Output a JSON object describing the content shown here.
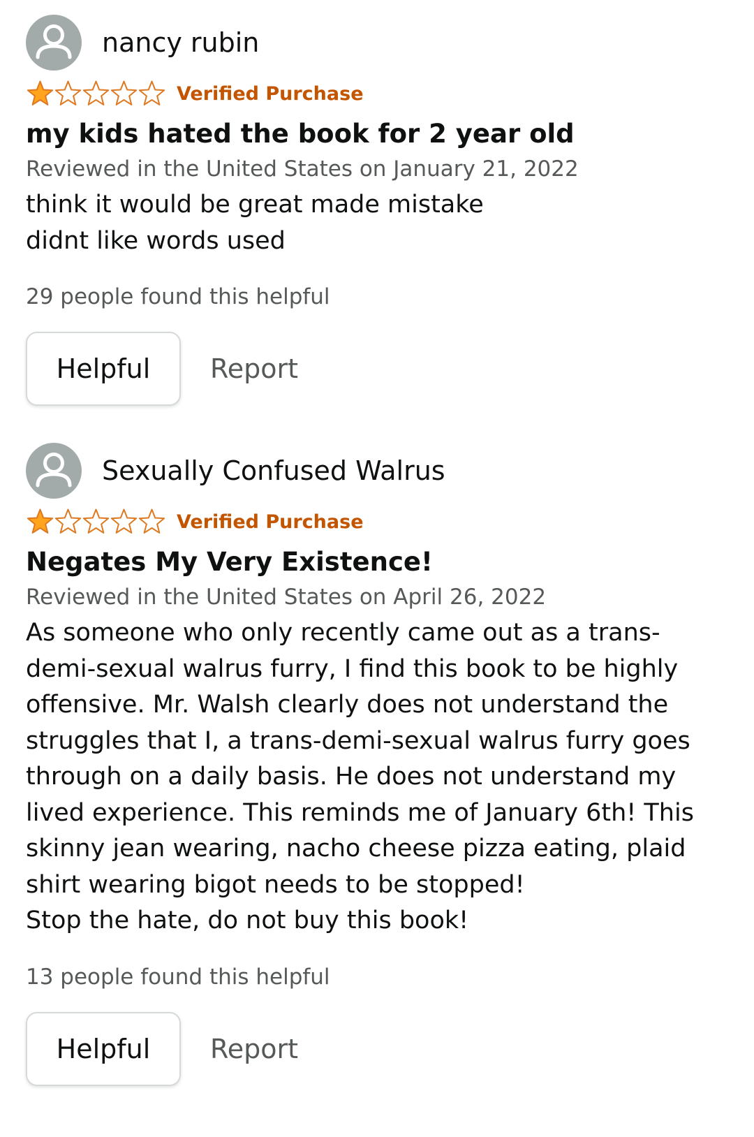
{
  "reviews": [
    {
      "author": "nancy rubin",
      "rating": 1,
      "max_rating": 5,
      "verified": "Verified Purchase",
      "title": "my kids hated the book for 2 year old",
      "date": "Reviewed in the United States on January 21, 2022",
      "body_lines": [
        "think it would be great made mistake",
        "didnt like words used"
      ],
      "helpful_count": "29 people found this helpful",
      "helpful_label": "Helpful",
      "report_label": "Report"
    },
    {
      "author": "Sexually Confused Walrus",
      "rating": 1,
      "max_rating": 5,
      "verified": "Verified Purchase",
      "title": "Negates My Very Existence!",
      "date": "Reviewed in the United States on April 26, 2022",
      "body_lines": [
        "As someone who only recently came out as a trans-",
        "demi-sexual walrus furry, I find this book to be highly",
        "offensive. Mr. Walsh clearly does not understand the",
        "struggles that I, a trans-demi-sexual walrus furry goes",
        "through on a daily basis. He does not understand my",
        "lived experience. This reminds me of January 6th! This",
        "skinny jean wearing, nacho cheese pizza eating, plaid",
        "shirt wearing bigot needs to be stopped!",
        "Stop the hate, do not buy this book!"
      ],
      "helpful_count": "13 people found this helpful",
      "helpful_label": "Helpful",
      "report_label": "Report"
    }
  ],
  "colors": {
    "star_fill": "#ffa41c",
    "star_outline": "#de7921",
    "verified": "#c45500",
    "secondary_text": "#565959",
    "avatar_bg": "#a3aaaa"
  },
  "icons": {
    "avatar": "user-silhouette-icon",
    "star_filled": "star-filled-icon",
    "star_empty": "star-empty-icon"
  }
}
